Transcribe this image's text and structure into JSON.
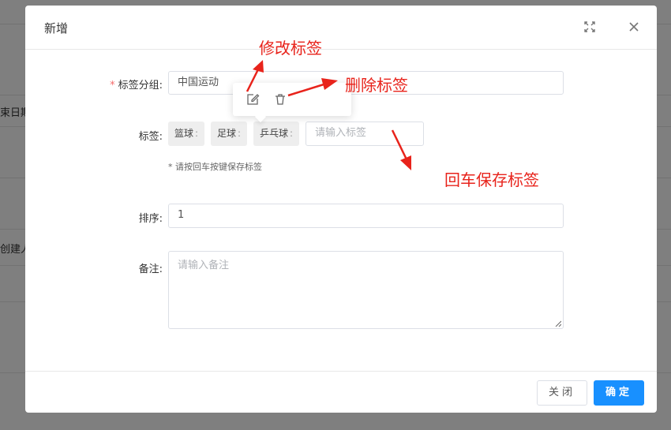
{
  "background": {
    "partial_text_1": "束日期",
    "partial_text_2": "创建人"
  },
  "dialog": {
    "title": "新增",
    "fullscreen_icon": "fullscreen-icon",
    "close_icon": "close-icon"
  },
  "form": {
    "group": {
      "required_mark": "*",
      "label": "标签分组:",
      "value": "中国运动"
    },
    "tags": {
      "label": "标签:",
      "items": [
        "篮球",
        "足球",
        "乒乓球"
      ],
      "separator": ":",
      "input_placeholder": "请输入标签",
      "hint": "* 请按回车按键保存标签"
    },
    "sort": {
      "label": "排序:",
      "value": "1"
    },
    "remark": {
      "label": "备注:",
      "placeholder": "请输入备注"
    }
  },
  "popover": {
    "edit_icon": "edit-icon",
    "delete_icon": "trash-icon"
  },
  "footer": {
    "close_label": "关闭",
    "confirm_label": "确定"
  },
  "annotations": {
    "edit": "修改标签",
    "delete": "删除标签",
    "enter_save": "回车保存标签",
    "color": "#e8231b"
  },
  "colors": {
    "primary": "#1890ff",
    "required": "#f56c6c"
  }
}
